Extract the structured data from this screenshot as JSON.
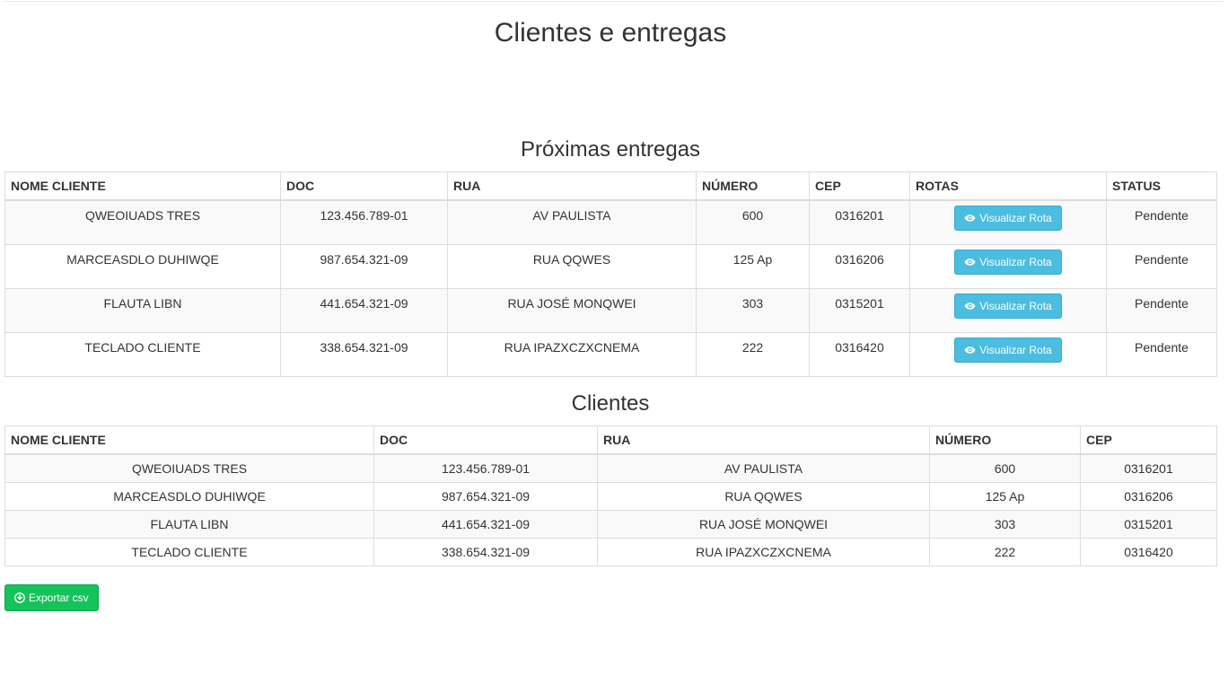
{
  "page": {
    "title": "Clientes e entregas"
  },
  "entregas": {
    "title": "Próximas entregas",
    "headers": [
      "NOME CLIENTE",
      "DOC",
      "RUA",
      "NÚMERO",
      "CEP",
      "ROTAS",
      "STATUS"
    ],
    "button_label": "Visualizar Rota",
    "button_icon": "eye-icon",
    "rows": [
      {
        "nome": "QWEOIUADS TRES",
        "doc": "123.456.789-01",
        "rua": "AV PAULISTA",
        "numero": "600",
        "cep": "0316201",
        "status": "Pendente"
      },
      {
        "nome": "MARCEASDLO DUHIWQE",
        "doc": "987.654.321-09",
        "rua": "RUA QQWES",
        "numero": "125 Ap",
        "cep": "0316206",
        "status": "Pendente"
      },
      {
        "nome": "FLAUTA LIBN",
        "doc": "441.654.321-09",
        "rua": "RUA JOSÉ MONQWEI",
        "numero": "303",
        "cep": "0315201",
        "status": "Pendente"
      },
      {
        "nome": "TECLADO CLIENTE",
        "doc": "338.654.321-09",
        "rua": "RUA IPAZXCZXCNEMA",
        "numero": "222",
        "cep": "0316420",
        "status": "Pendente"
      }
    ]
  },
  "clientes": {
    "title": "Clientes",
    "headers": [
      "NOME CLIENTE",
      "DOC",
      "RUA",
      "NÚMERO",
      "CEP"
    ],
    "rows": [
      {
        "nome": "QWEOIUADS TRES",
        "doc": "123.456.789-01",
        "rua": "AV PAULISTA",
        "numero": "600",
        "cep": "0316201"
      },
      {
        "nome": "MARCEASDLO DUHIWQE",
        "doc": "987.654.321-09",
        "rua": "RUA QQWES",
        "numero": "125 Ap",
        "cep": "0316206"
      },
      {
        "nome": "FLAUTA LIBN",
        "doc": "441.654.321-09",
        "rua": "RUA JOSÉ MONQWEI",
        "numero": "303",
        "cep": "0315201"
      },
      {
        "nome": "TECLADO CLIENTE",
        "doc": "338.654.321-09",
        "rua": "RUA IPAZXCZXCNEMA",
        "numero": "222",
        "cep": "0316420"
      }
    ]
  },
  "export": {
    "label": "Exportar csv",
    "icon": "download-circle-icon"
  },
  "colors": {
    "info_button": "#4bbde0",
    "success_button": "#14c35a",
    "row_stripe": "#f9f9f9",
    "border": "#dddddd"
  }
}
